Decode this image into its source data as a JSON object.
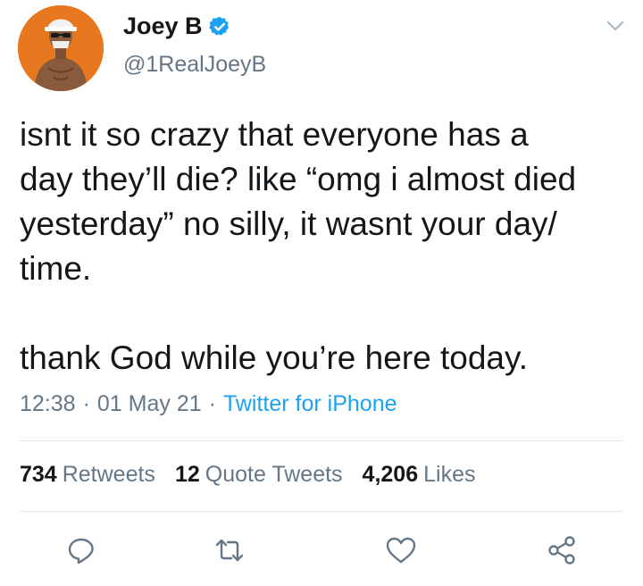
{
  "author": {
    "display_name": "Joey B",
    "handle": "@1RealJoeyB",
    "verified": true
  },
  "tweet": {
    "text": "isnt it so crazy that everyone has a\nday they’ll die? like “omg i almost died\nyesterday” no silly, it wasnt your day/\ntime.\n\nthank God while you’re here today.",
    "time": "12:38",
    "date": "01 May 21",
    "separator": "·",
    "source": "Twitter for iPhone"
  },
  "stats": {
    "retweets_count": "734",
    "retweets_label": "Retweets",
    "quotes_count": "12",
    "quotes_label": "Quote Tweets",
    "likes_count": "4,206",
    "likes_label": "Likes"
  },
  "icons": {
    "reply": "reply-icon",
    "retweet": "retweet-icon",
    "like": "heart-icon",
    "share": "share-icon",
    "more": "chevron-down-icon",
    "verified": "verified-badge-icon"
  },
  "colors": {
    "text": "#14171a",
    "secondary": "#657786",
    "accent": "#1da1f2",
    "divider": "#e1e8ed",
    "avatar_bg": "#e8781f"
  }
}
